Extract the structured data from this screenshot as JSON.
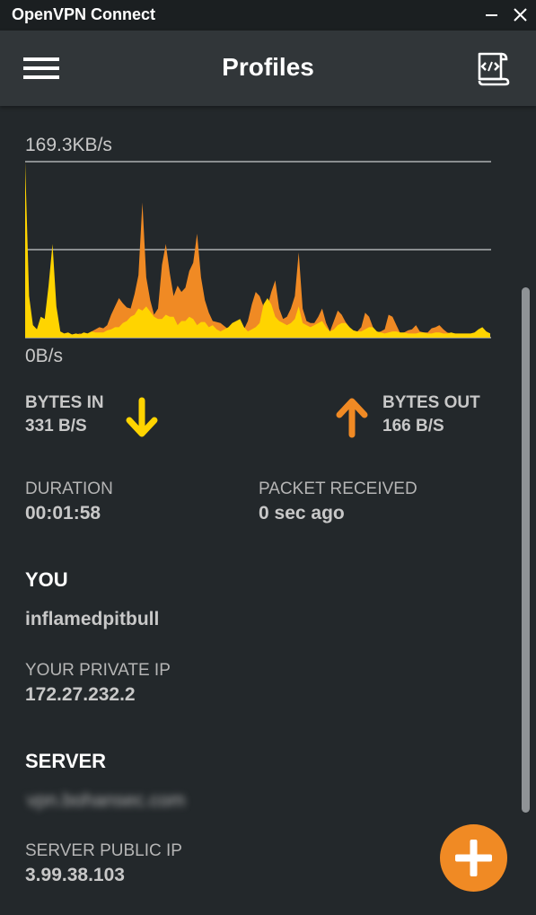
{
  "window": {
    "title": "OpenVPN Connect"
  },
  "header": {
    "title": "Profiles"
  },
  "icons": {
    "menu": "hamburger-menu-icon",
    "log": "log-scroll-icon",
    "minimize": "minimize-icon",
    "close": "close-icon",
    "bytes_in": "arrow-down-icon",
    "bytes_out": "arrow-up-icon",
    "add": "plus-icon"
  },
  "colors": {
    "bytes_in": "#ffd400",
    "bytes_out": "#f08a24",
    "background": "#23282b",
    "header": "#313639"
  },
  "chart_data": {
    "type": "area",
    "title": "",
    "y_max_label": "169.3KB/s",
    "y_min_label": "0B/s",
    "ylim": [
      0,
      169.3
    ],
    "y_unit": "KB/s",
    "series": [
      {
        "name": "BYTES OUT",
        "color": "#f08a24",
        "values": [
          3,
          3,
          3,
          3,
          3,
          3,
          3,
          3,
          3,
          3,
          3,
          3,
          3,
          3,
          4,
          3,
          4,
          6,
          8,
          10,
          9,
          12,
          22,
          30,
          38,
          33,
          29,
          28,
          42,
          60,
          130,
          58,
          36,
          22,
          28,
          70,
          90,
          62,
          40,
          50,
          44,
          48,
          64,
          72,
          100,
          58,
          36,
          24,
          16,
          15,
          14,
          11,
          8,
          7,
          6,
          6,
          8,
          16,
          32,
          44,
          40,
          30,
          30,
          44,
          55,
          28,
          18,
          20,
          28,
          40,
          82,
          28,
          16,
          14,
          14,
          20,
          28,
          14,
          6,
          16,
          26,
          22,
          15,
          10,
          6,
          6,
          10,
          24,
          20,
          10,
          5,
          6,
          8,
          22,
          20,
          12,
          4,
          5,
          7,
          8,
          12,
          6,
          5,
          5,
          9,
          10,
          12,
          8,
          5,
          4,
          4,
          3,
          3,
          3,
          3,
          4,
          6,
          5,
          4,
          4
        ]
      },
      {
        "name": "BYTES IN",
        "color": "#ffd400",
        "values": [
          170,
          40,
          12,
          8,
          20,
          18,
          50,
          90,
          30,
          6,
          4,
          5,
          3,
          4,
          3,
          5,
          4,
          6,
          5,
          5,
          5,
          7,
          8,
          10,
          10,
          14,
          16,
          20,
          22,
          28,
          26,
          30,
          25,
          20,
          18,
          18,
          22,
          20,
          20,
          12,
          16,
          16,
          20,
          18,
          12,
          15,
          15,
          10,
          12,
          8,
          6,
          8,
          10,
          14,
          16,
          18,
          10,
          6,
          8,
          10,
          14,
          32,
          38,
          32,
          20,
          16,
          14,
          12,
          14,
          18,
          30,
          14,
          12,
          10,
          12,
          14,
          16,
          10,
          6,
          8,
          12,
          14,
          14,
          10,
          7,
          6,
          6,
          8,
          10,
          10,
          6,
          5,
          4,
          5,
          6,
          6,
          5,
          5,
          4,
          4,
          4,
          5,
          5,
          4,
          4,
          5,
          5,
          4,
          4,
          5,
          4,
          4,
          4,
          4,
          4,
          5,
          8,
          10,
          6,
          4
        ]
      }
    ]
  },
  "traffic": {
    "bytes_in_label": "BYTES IN",
    "bytes_in_value": "331 B/S",
    "bytes_out_label": "BYTES OUT",
    "bytes_out_value": "166 B/S"
  },
  "stats": {
    "duration_label": "DURATION",
    "duration_value": "00:01:58",
    "packet_label": "PACKET RECEIVED",
    "packet_value": "0 sec ago"
  },
  "you": {
    "heading": "YOU",
    "username": "inflamedpitbull",
    "private_ip_label": "YOUR PRIVATE IP",
    "private_ip_value": "172.27.232.2"
  },
  "server": {
    "heading": "SERVER",
    "hostname": "vpn.bohansec.com",
    "public_ip_label": "SERVER PUBLIC IP",
    "public_ip_value": "3.99.38.103"
  }
}
